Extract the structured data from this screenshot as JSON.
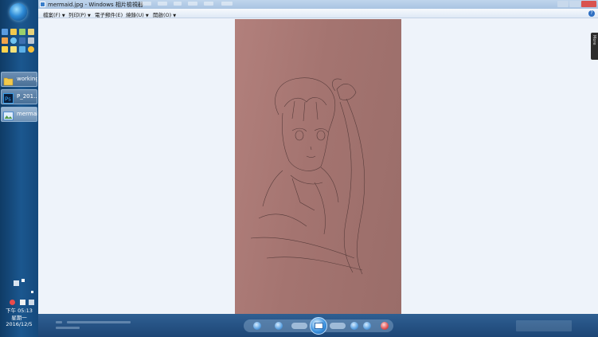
{
  "window": {
    "title": "mermaid.jpg - Windows 相片檢視器"
  },
  "menu": {
    "items": [
      {
        "label": "檔案(F)"
      },
      {
        "label": "列印(P)"
      },
      {
        "label": "電子郵件(E)"
      },
      {
        "label": "燒錄(U)"
      },
      {
        "label": "開啟(O)"
      }
    ],
    "caret": "▼",
    "help": "?"
  },
  "taskbar": {
    "tasks": [
      {
        "label": "working",
        "icon": "folder-icon"
      },
      {
        "label": "P_201...",
        "icon": "photoshop-icon"
      },
      {
        "label": "mermai...",
        "icon": "photo-viewer-icon"
      }
    ],
    "clock": {
      "time": "下午 05:13",
      "weekday": "星期一",
      "date": "2016/12/5"
    }
  },
  "side_tab": {
    "label": "More"
  },
  "colors": {
    "taskbar": "#1b578f",
    "photo_bg": "#a47470",
    "viewer_bg": "#eef3fa",
    "toolbar": "#2f5f92"
  }
}
